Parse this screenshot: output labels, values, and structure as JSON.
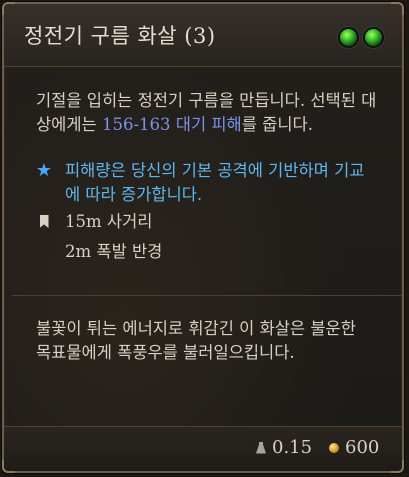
{
  "tooltip": {
    "title": "정전기 구름 화살 (3)",
    "description": {
      "part1": "기절을 입히는 정전기 구름을 만듭니다. 선택된 대상에게는 ",
      "damage": "156-163 대기 피해",
      "part2": "를 줍니다."
    },
    "note": "피해량은 당신의 기본 공격에 기반하며 기교에 따라 증가합니다.",
    "range": "15m 사거리",
    "radius": "2m 폭발 반경",
    "flavor": "불꽃이 튀는 에너지로 휘감긴 이 화살은 불운한 목표물에게 폭풍우를 불러일으킵니다.",
    "weight": "0.15",
    "price": "600"
  },
  "colors": {
    "damage_highlight": "#7b93e6",
    "note": "#5fb6f0",
    "star": "#4aa6ff",
    "orb": "#3fbf2a"
  },
  "icons": {
    "star": "star-icon",
    "range": "bookmark-flag-icon",
    "weight": "weight-icon",
    "price": "gold-coin-icon",
    "orbs": "green-orb-icon"
  }
}
